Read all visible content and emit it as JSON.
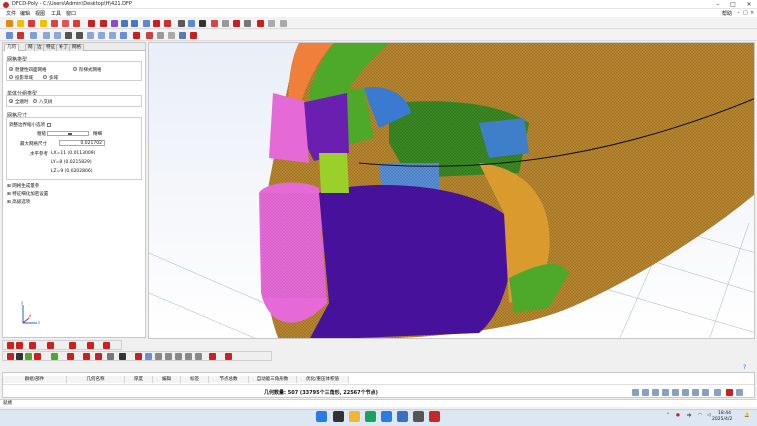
{
  "window": {
    "title": "DFCD-Poly - C:\\Users\\Admin\\Desktop\\H\\421.DFP",
    "minimize_icon": "minimize-icon",
    "maximize_icon": "maximize-icon",
    "close_icon": "close-icon"
  },
  "menu": {
    "items": [
      "文件",
      "编辑",
      "视图",
      "工具",
      "窗口"
    ],
    "help_label": "帮助"
  },
  "left_panel": {
    "tabs": [
      "几何",
      "网",
      "边",
      "特征",
      "补丁",
      "网格"
    ],
    "mesh_type": {
      "title": "网格类型",
      "options": [
        "稳健性四面网格",
        "阶梯式网格",
        "投影草域",
        "多域"
      ]
    },
    "surface_type": {
      "title": "单体分组类型",
      "options": [
        "全顺时",
        "八叉树"
      ]
    },
    "mesh_size": {
      "title": "网格尺寸",
      "adjust_label": "调整边界缩小选项",
      "coarse_label": "粗糙",
      "fine_label": "精细",
      "max_size_label": "最大网格尺寸",
      "max_size_value": "0.021702",
      "level_label": "水平参考",
      "lx": "LX=11 (0.0113009)",
      "ly": "LY=8 (0.0215829)",
      "lz": "LZ=9 (0.0202806)"
    },
    "tree": [
      "网格生成量参",
      "特征细化加密设置",
      "高级选项"
    ]
  },
  "table": {
    "headers": [
      "群组/部件",
      "几何名称",
      "厚度",
      "编辑",
      "标签",
      "节点总数",
      "自动能三角形数",
      "优化/重压体积值"
    ]
  },
  "status": {
    "stats": "几何数量: 507 (33795个三角形, 22567个节点)",
    "message": "就绪"
  },
  "taskbar": {
    "time": "18:44",
    "date": "2025/4/2",
    "ime": "中"
  },
  "colors": {
    "accent": "#1b6ad1",
    "panel_bg": "#ffffff",
    "taskbar_bg": "#dde7f3"
  }
}
